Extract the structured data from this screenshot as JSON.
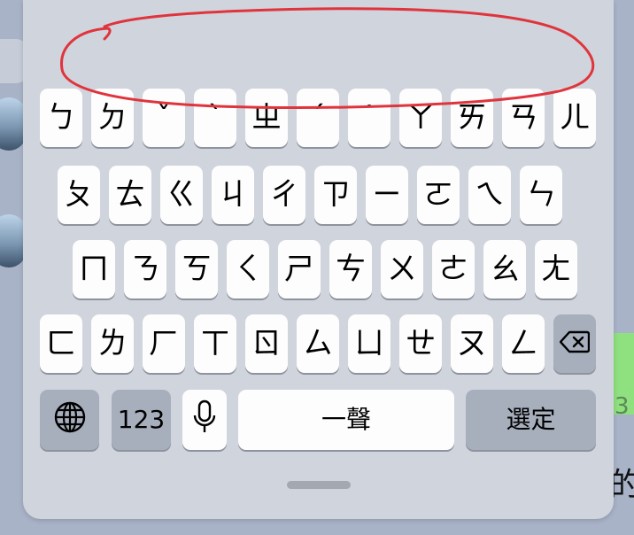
{
  "keyboard": {
    "row1": [
      "ㄅ",
      "ㄉ",
      "ˇ",
      "ˋ",
      "ㄓ",
      "ˊ",
      "˙",
      "ㄚ",
      "ㄞ",
      "ㄢ",
      "ㄦ"
    ],
    "row2": [
      "ㄆ",
      "ㄊ",
      "ㄍ",
      "ㄐ",
      "ㄔ",
      "ㄗ",
      "ㄧ",
      "ㄛ",
      "ㄟ",
      "ㄣ"
    ],
    "row3": [
      "ㄇ",
      "ㄋ",
      "ㄎ",
      "ㄑ",
      "ㄕ",
      "ㄘ",
      "ㄨ",
      "ㄜ",
      "ㄠ",
      "ㄤ"
    ],
    "row4": [
      "ㄈ",
      "ㄌ",
      "ㄏ",
      "ㄒ",
      "ㄖ",
      "ㄙ",
      "ㄩ",
      "ㄝ",
      "ㄡ",
      "ㄥ"
    ],
    "numbers_label": "123",
    "space_label": "一聲",
    "confirm_label": "選定",
    "icons": {
      "globe": "globe-icon",
      "mic": "microphone-icon",
      "delete": "delete-backspace-icon"
    }
  },
  "background": {
    "partial_text": "3",
    "partial_char": "的"
  },
  "colors": {
    "keyboard_bg": "#d0d4dd",
    "key_bg": "#fdfdfe",
    "function_key_bg": "#a7afbd",
    "annotation": "#e0343c"
  }
}
